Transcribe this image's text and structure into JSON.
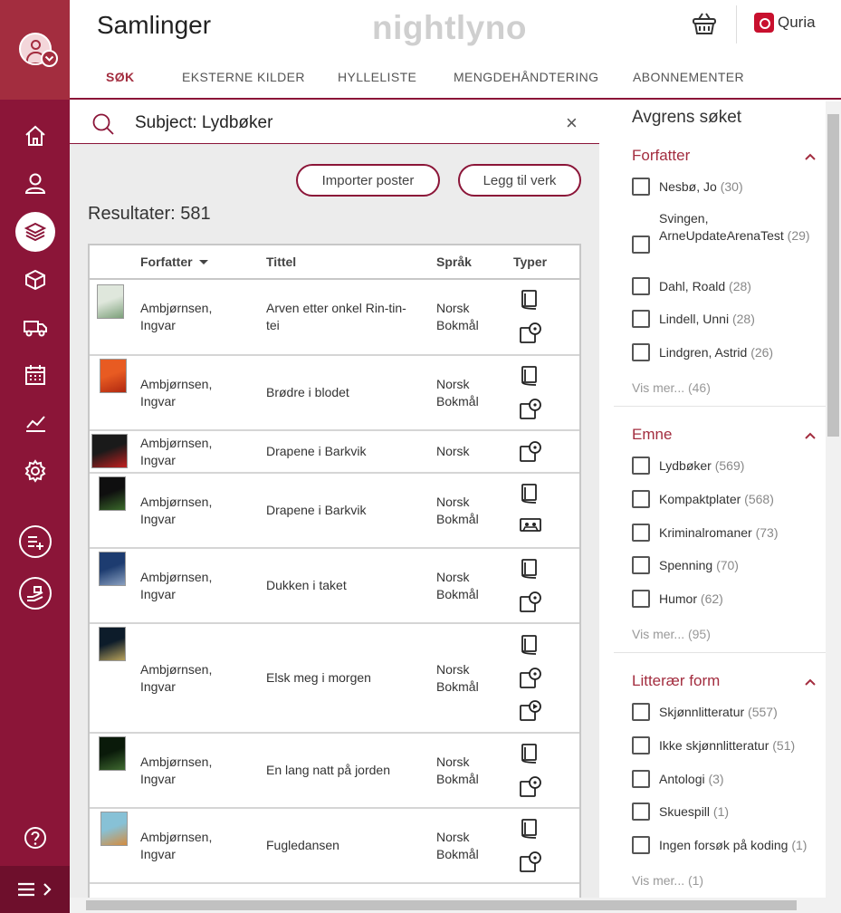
{
  "header": {
    "title": "Samlinger",
    "brand": "nightlyno",
    "quria_label": "Quria",
    "tabs": [
      {
        "label": "SØK",
        "active": true
      },
      {
        "label": "EKSTERNE KILDER",
        "active": false
      },
      {
        "label": "HYLLELISTE",
        "active": false
      },
      {
        "label": "MENGDEHÅNDTERING",
        "active": false
      },
      {
        "label": "ABONNEMENTER",
        "active": false
      }
    ]
  },
  "sidebar": {
    "items": [
      "home-icon",
      "user-icon",
      "layers-icon",
      "box-icon",
      "truck-icon",
      "calendar-icon",
      "chart-icon",
      "gear-icon"
    ],
    "actions": [
      "add-list-icon",
      "hand-offer-icon"
    ],
    "help": "help-icon",
    "menu": "menu-icon"
  },
  "search": {
    "value": "Subject: Lydbøker",
    "clear": "×"
  },
  "buttons": {
    "import": "Importer poster",
    "add_work": "Legg til verk"
  },
  "results": {
    "count_label": "Resultater: 581",
    "columns": [
      "Forfatter",
      "Tittel",
      "Språk",
      "Typer"
    ],
    "rows": [
      {
        "author": [
          "Ambjørnsen,",
          "Ingvar"
        ],
        "title": [
          "Arven etter onkel Rin-tin-",
          "tei"
        ],
        "language": [
          "Norsk",
          "Bokmål"
        ],
        "types": [
          "book",
          "cd"
        ]
      },
      {
        "author": [
          "Ambjørnsen,",
          "Ingvar"
        ],
        "title": [
          "Brødre i blodet",
          ""
        ],
        "language": [
          "Norsk",
          "Bokmål"
        ],
        "types": [
          "book",
          "cd"
        ]
      },
      {
        "author": [
          "Ambjørnsen,",
          "Ingvar"
        ],
        "title": [
          "Drapene i Barkvik",
          ""
        ],
        "language": [
          "Norsk",
          ""
        ],
        "types": [
          "cd"
        ]
      },
      {
        "author": [
          "Ambjørnsen,",
          "Ingvar"
        ],
        "title": [
          "Drapene i Barkvik",
          ""
        ],
        "language": [
          "Norsk",
          "Bokmål"
        ],
        "types": [
          "book",
          "cassette"
        ]
      },
      {
        "author": [
          "Ambjørnsen,",
          "Ingvar"
        ],
        "title": [
          "Dukken i taket",
          ""
        ],
        "language": [
          "Norsk",
          "Bokmål"
        ],
        "types": [
          "book",
          "cd"
        ]
      },
      {
        "author": [
          "Ambjørnsen,",
          "Ingvar"
        ],
        "title": [
          "Elsk meg i morgen",
          ""
        ],
        "language": [
          "Norsk",
          "Bokmål"
        ],
        "types": [
          "book",
          "cd",
          "play"
        ]
      },
      {
        "author": [
          "Ambjørnsen,",
          "Ingvar"
        ],
        "title": [
          "En lang natt på jorden",
          ""
        ],
        "language": [
          "Norsk",
          "Bokmål"
        ],
        "types": [
          "book",
          "cd"
        ]
      },
      {
        "author": [
          "Ambjørnsen,",
          "Ingvar"
        ],
        "title": [
          "Fugledansen",
          ""
        ],
        "language": [
          "Norsk",
          "Bokmål"
        ],
        "types": [
          "book",
          "cd"
        ]
      }
    ]
  },
  "facets": {
    "title": "Avgrens søket",
    "groups": [
      {
        "name": "Forfatter",
        "items": [
          {
            "label": "Nesbø, Jo",
            "count": "(30)"
          },
          {
            "label": "Svingen, ArneUpdateArenaTest",
            "count": "(29)"
          },
          {
            "label": "Dahl, Roald",
            "count": "(28)"
          },
          {
            "label": "Lindell, Unni",
            "count": "(28)"
          },
          {
            "label": "Lindgren, Astrid",
            "count": "(26)"
          }
        ],
        "more": "Vis mer... (46)"
      },
      {
        "name": "Emne",
        "items": [
          {
            "label": "Lydbøker",
            "count": "(569)"
          },
          {
            "label": "Kompaktplater",
            "count": "(568)"
          },
          {
            "label": "Kriminalromaner",
            "count": "(73)"
          },
          {
            "label": "Spenning",
            "count": "(70)"
          },
          {
            "label": "Humor",
            "count": "(62)"
          }
        ],
        "more": "Vis mer... (95)"
      },
      {
        "name": "Litterær form",
        "items": [
          {
            "label": "Skjønnlitteratur",
            "count": "(557)"
          },
          {
            "label": "Ikke skjønnlitteratur",
            "count": "(51)"
          },
          {
            "label": "Antologi",
            "count": "(3)"
          },
          {
            "label": "Skuespill",
            "count": "(1)"
          },
          {
            "label": "Ingen forsøk på koding",
            "count": "(1)"
          }
        ],
        "more": "Vis mer... (1)"
      }
    ]
  },
  "colors": {
    "brand": "#8b1538",
    "accent": "#a32d3f"
  }
}
